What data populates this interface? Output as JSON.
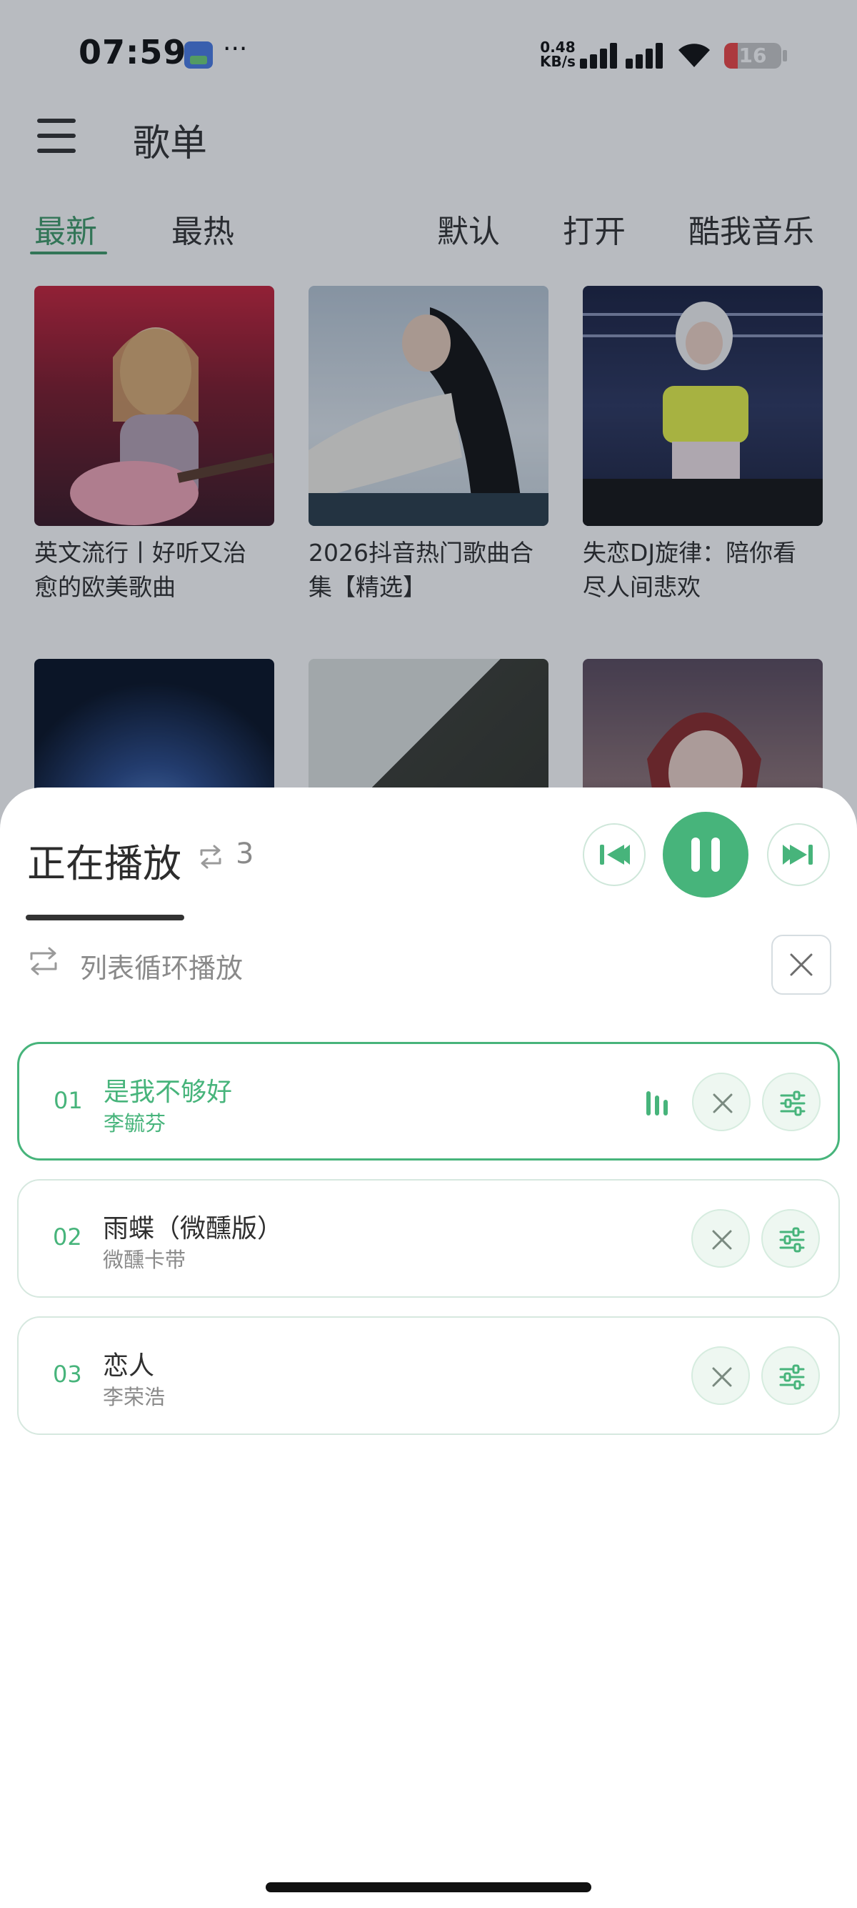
{
  "status_bar": {
    "time": "07:59",
    "network_speed_value": "0.48",
    "network_speed_unit": "KB/s",
    "battery_level": "16",
    "more_indicator": "···",
    "icons": [
      "app-notification-icon",
      "cell-signal-icon",
      "wifi-icon",
      "battery-icon"
    ]
  },
  "header": {
    "title": "歌单",
    "menu_icon": "hamburger-menu-icon"
  },
  "tabs": {
    "latest": "最新",
    "hot": "最热",
    "default": "默认",
    "open": "打开",
    "source": "酷我音乐",
    "active": "最新"
  },
  "playlists": [
    {
      "title": "英文流行丨好听又治愈的欧美歌曲",
      "line1": "英文流行丨好听又治",
      "line2": "愈的欧美歌曲"
    },
    {
      "title": "2026抖音热门歌曲合集【精选】",
      "line1": "2026抖音热门歌曲合",
      "line2": "集【精选】"
    },
    {
      "title": "失恋DJ旋律：陪你看尽人间悲欢",
      "line1": "失恋DJ旋律：陪你看",
      "line2": "尽人间悲欢"
    },
    {
      "title": ""
    },
    {
      "title": ""
    },
    {
      "title": ""
    }
  ],
  "now_playing": {
    "title": "正在播放",
    "queue_count": "3",
    "play_mode": "列表循环播放",
    "state": "playing",
    "accent_color": "#47b47b",
    "tracks": [
      {
        "number": "01",
        "title": "是我不够好",
        "artist": "李毓芬",
        "active": true
      },
      {
        "number": "02",
        "title": "雨蝶（微醺版）",
        "artist": "微醺卡带",
        "active": false
      },
      {
        "number": "03",
        "title": "恋人",
        "artist": "李荣浩",
        "active": false
      }
    ]
  }
}
